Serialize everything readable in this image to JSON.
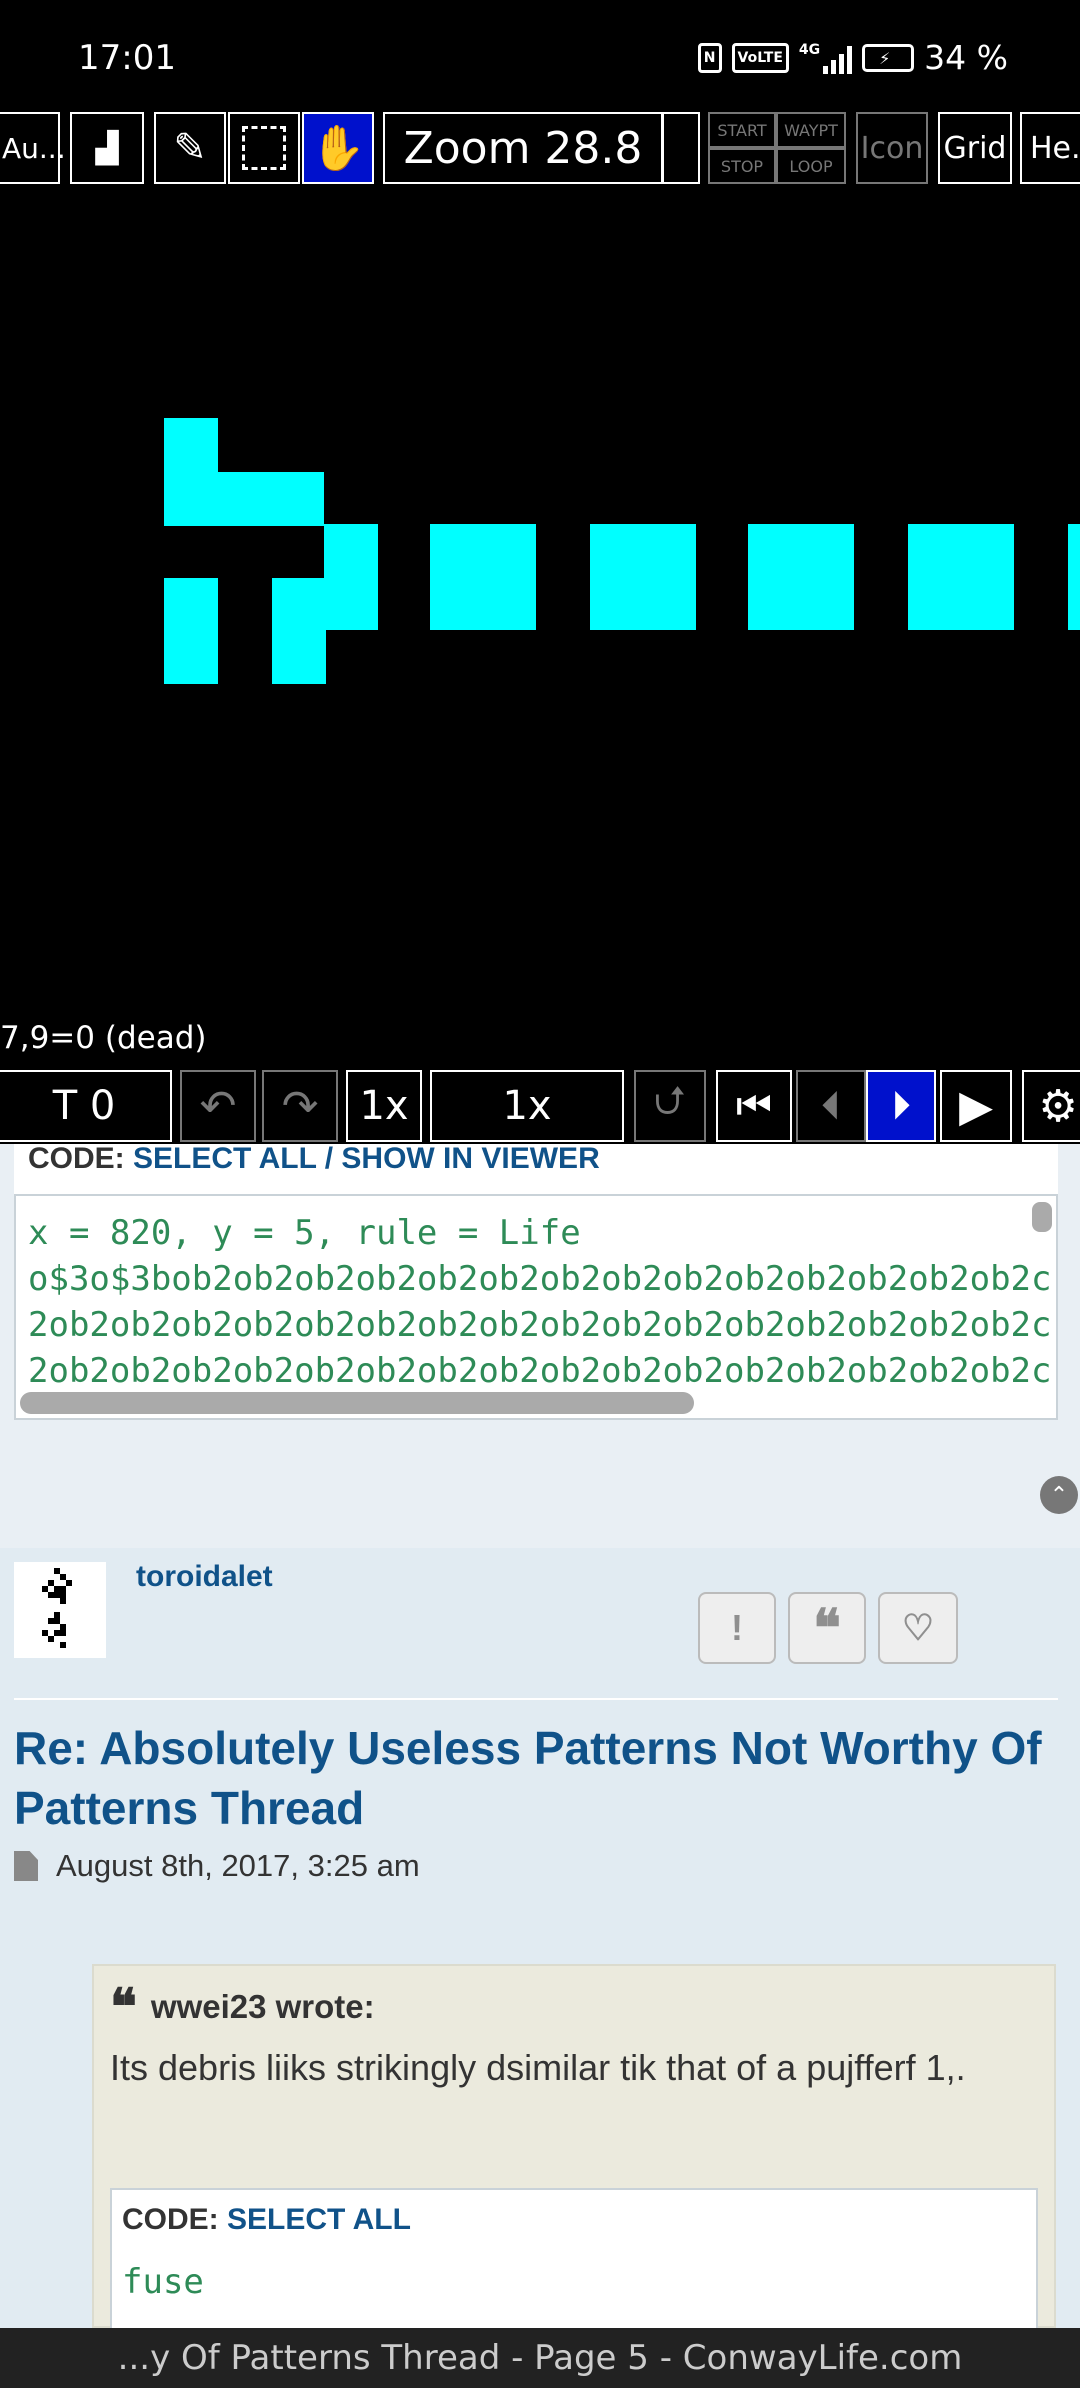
{
  "status_bar": {
    "time": "17:01",
    "nfc": "N",
    "volte": "VoLTE",
    "network": "4G",
    "battery": "34 %"
  },
  "viewer": {
    "toolbar": {
      "autofit": "Au...",
      "zoom": "Zoom 28.8",
      "start": "START",
      "waypt": "WAYPT",
      "stop": "STOP",
      "loop": "LOOP",
      "icon": "Icon",
      "grid": "Grid",
      "help": "He..."
    },
    "cell_info": "7,9=0 (dead)",
    "controls": {
      "generation": "T 0",
      "step": "1x",
      "speed": "1x"
    }
  },
  "code_block_1": {
    "label": "CODE:",
    "select_all": "SELECT ALL",
    "separator": "/",
    "show_in_viewer": "SHOW IN VIEWER",
    "lines": [
      "x = 820, y = 5, rule = Life",
      "o$3o$3bob2ob2ob2ob2ob2ob2ob2ob2ob2ob2ob2ob2ob2ob2c",
      "2ob2ob2ob2ob2ob2ob2ob2ob2ob2ob2ob2ob2ob2ob2ob2ob2c",
      "2ob2ob2ob2ob2ob2ob2ob2ob2ob2ob2ob2ob2ob2ob2ob2ob2c"
    ]
  },
  "post": {
    "author": "toroidalet",
    "title": "Re: Absolutely Useless Patterns Not Worthy Of Patterns Thread",
    "date": "August 8th, 2017, 3:25 am",
    "quote": {
      "author": "wwei23 wrote:",
      "text": "Its debris liiks strikingly dsimilar tik that of a pujfferf 1,.",
      "code_label": "CODE:",
      "code_select_all": "SELECT ALL",
      "code": "fuse"
    }
  },
  "bottom_bar": {
    "title": "...y Of Patterns Thread - Page 5 - ConwayLife.com"
  },
  "colors": {
    "cell": "#00ffff",
    "accent": "#105289",
    "code_text": "#2e8b57",
    "selected_tool": "#0011cc"
  }
}
